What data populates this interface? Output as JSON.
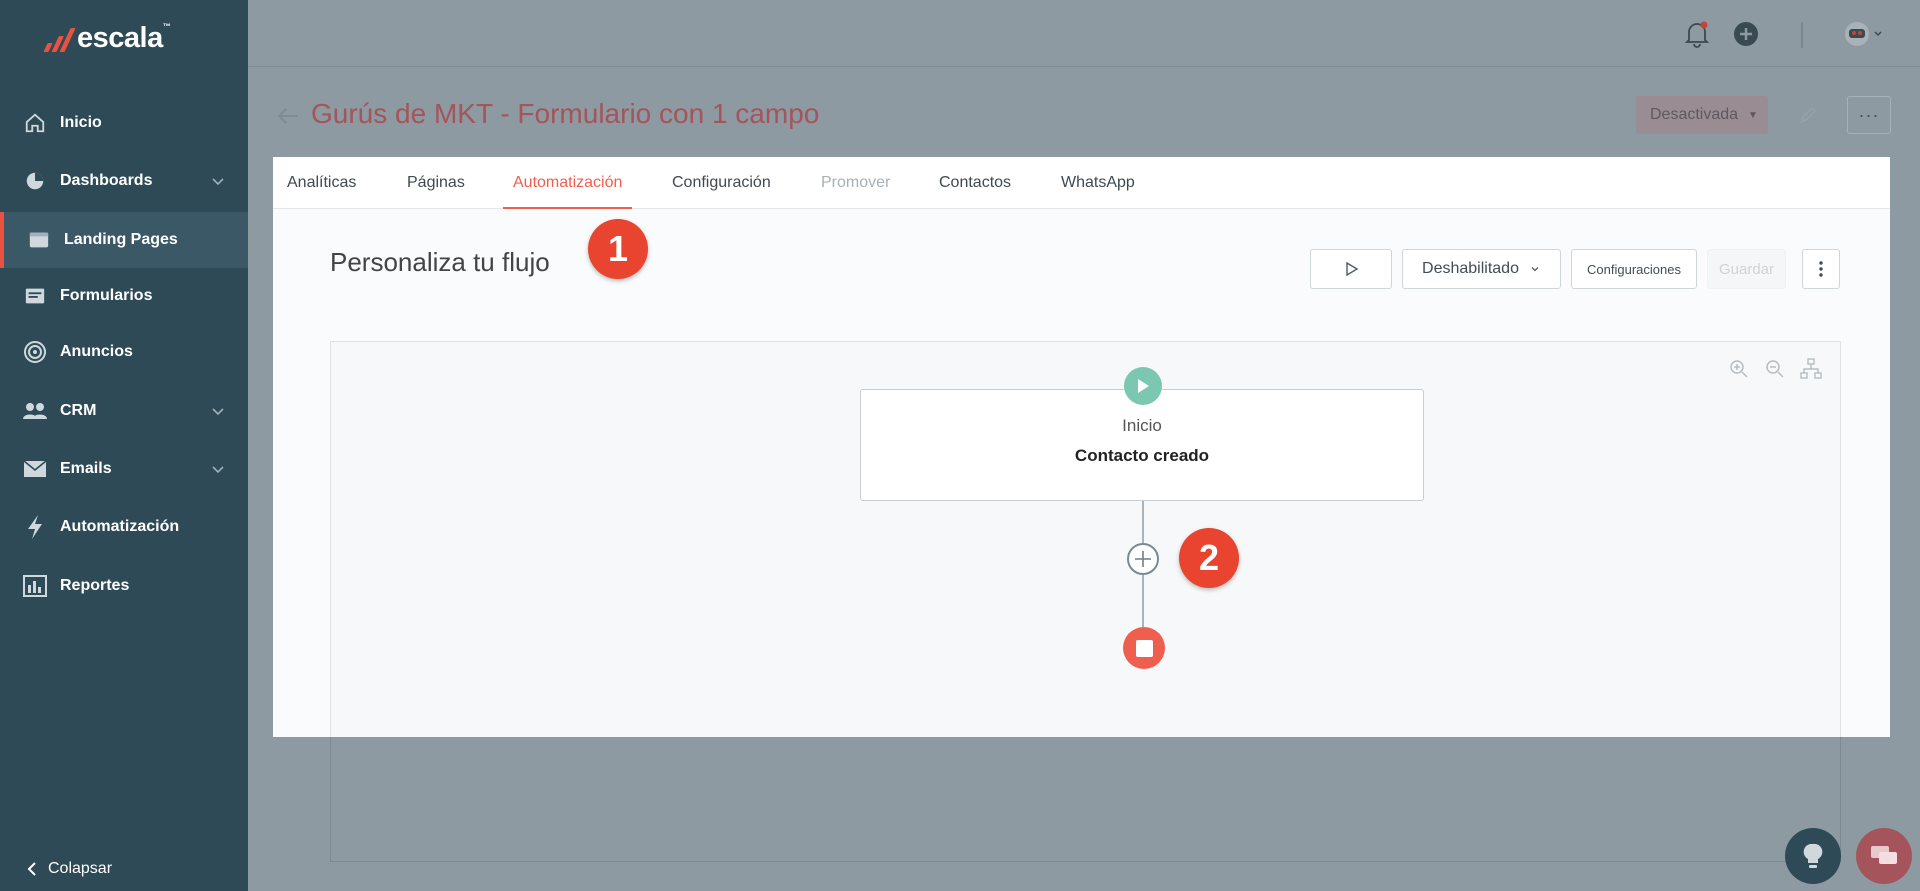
{
  "app": {
    "brand": "escala",
    "brand_tm": "™"
  },
  "sidebar": {
    "items": [
      {
        "label": "Inicio",
        "icon": "home-icon"
      },
      {
        "label": "Dashboards",
        "icon": "pie-chart-icon",
        "has_chevron": true
      },
      {
        "label": "Landing Pages",
        "icon": "browser-window-icon",
        "active": true
      },
      {
        "label": "Formularios",
        "icon": "form-icon"
      },
      {
        "label": "Anuncios",
        "icon": "target-icon"
      },
      {
        "label": "CRM",
        "icon": "people-icon",
        "has_chevron": true
      },
      {
        "label": "Emails",
        "icon": "envelope-icon",
        "has_chevron": true
      },
      {
        "label": "Automatización",
        "icon": "lightning-icon"
      },
      {
        "label": "Reportes",
        "icon": "report-icon"
      }
    ],
    "collapse_label": "Colapsar"
  },
  "topbar": {
    "icons": [
      "bell-icon",
      "plus-circle-icon",
      "avatar-robot-icon"
    ]
  },
  "header": {
    "title": "Gurús de MKT - Formulario con 1 campo",
    "status_button": "Desactivada"
  },
  "tabs": [
    {
      "label": "Analíticas"
    },
    {
      "label": "Páginas"
    },
    {
      "label": "Automatización",
      "active": true
    },
    {
      "label": "Configuración"
    },
    {
      "label": "Promover",
      "disabled": true
    },
    {
      "label": "Contactos"
    },
    {
      "label": "WhatsApp"
    }
  ],
  "flow": {
    "title": "Personaliza tu flujo",
    "status_select": "Deshabilitado",
    "config_button": "Configuraciones",
    "save_button": "Guardar",
    "node": {
      "type": "Inicio",
      "name": "Contacto creado"
    }
  },
  "badges": {
    "one": "1",
    "two": "2"
  },
  "colors": {
    "accent": "#ef5f4f",
    "sidebar": "#2d4a56",
    "start": "#7cc7b1",
    "badge": "#e8442f"
  }
}
